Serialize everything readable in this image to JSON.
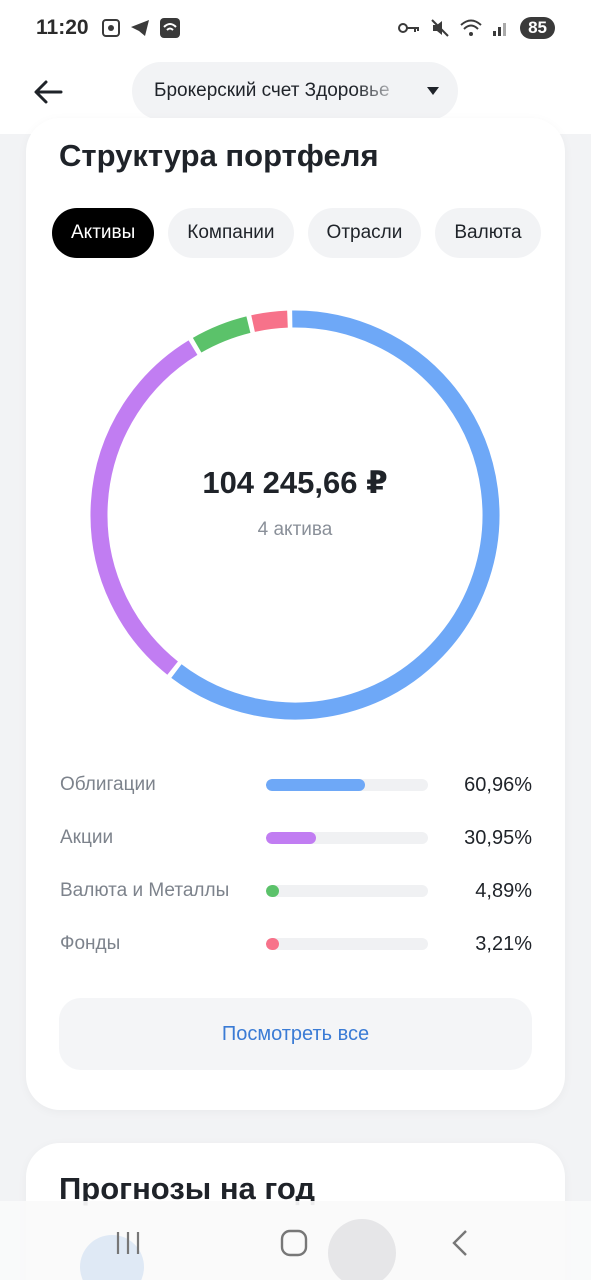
{
  "status_bar": {
    "time": "11:20",
    "battery": "85"
  },
  "header": {
    "account_label": "Брокерский счет Здоровье",
    "back_icon": "arrow-left-icon",
    "caret_icon": "caret-down-icon"
  },
  "structure": {
    "title": "Структура портфеля",
    "tabs": [
      {
        "label": "Активы",
        "active": true
      },
      {
        "label": "Компании",
        "active": false
      },
      {
        "label": "Отрасли",
        "active": false
      },
      {
        "label": "Валюта",
        "active": false
      }
    ],
    "total": "104 245,66 ₽",
    "assets_count": "4 актива",
    "items": [
      {
        "name": "Облигации",
        "percent": "60,96%",
        "share": 60.96,
        "color": "#6ea8f7"
      },
      {
        "name": "Акции",
        "percent": "30,95%",
        "share": 30.95,
        "color": "#c17df2"
      },
      {
        "name": "Валюта и Металлы",
        "percent": "4,89%",
        "share": 4.89,
        "color": "#5bc26a"
      },
      {
        "name": "Фонды",
        "percent": "3,21%",
        "share": 3.21,
        "color": "#f7728a"
      }
    ],
    "view_all": "Посмотреть все"
  },
  "forecast": {
    "title": "Прогнозы на год"
  }
}
